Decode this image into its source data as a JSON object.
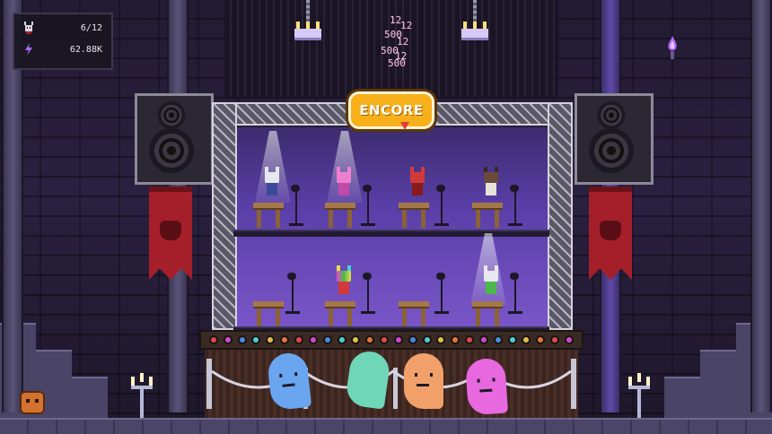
{
  "hud": {
    "fans_icon": "demon-head-icon",
    "fans_count": "6/12",
    "energy_icon": "lightning-icon",
    "energy_value": "62.88K"
  },
  "score_popups": [
    "12",
    "12",
    "500",
    "12",
    "500",
    "12",
    "500"
  ],
  "encore_button": {
    "label": "ENCORE"
  },
  "colors": {
    "stage_purple": "#5a3fa8",
    "encore_orange": "#f7b01a",
    "banner_red": "#a51f2b",
    "ghost_blue": "#6aa6f0",
    "ghost_teal": "#6fd6b8",
    "ghost_orange": "#f2a06a",
    "ghost_pink": "#e868e0"
  },
  "performers_top": [
    {
      "name": "white-demon-performer",
      "color": "#e8e8f0",
      "spotlight": true
    },
    {
      "name": "pink-demon-performer",
      "color": "#ee7fd0",
      "spotlight": true
    },
    {
      "name": "red-demon-performer",
      "color": "#d23a3a",
      "spotlight": false
    },
    {
      "name": "brown-demon-performer",
      "color": "#5a3a2a",
      "spotlight": false
    }
  ],
  "performers_bottom": [
    {
      "name": "empty-seat",
      "color": null,
      "spotlight": false
    },
    {
      "name": "rainbow-demon-performer",
      "color": "#e84ad0",
      "spotlight": false
    },
    {
      "name": "empty-seat",
      "color": null,
      "spotlight": false
    },
    {
      "name": "green-demon-performer",
      "color": "#4ab84a",
      "spotlight": true
    }
  ],
  "stage_lights": [
    "#e04a4a",
    "#d04ad0",
    "#4a8ae0",
    "#4ad0d0",
    "#e0c04a",
    "#e07a3a",
    "#e04a4a",
    "#d04ad0",
    "#4a8ae0",
    "#4ad0d0",
    "#e0c04a",
    "#e07a3a",
    "#e04a4a",
    "#d04ad0",
    "#4a8ae0",
    "#4ad0d0",
    "#e0c04a",
    "#e07a3a",
    "#e04a4a",
    "#d04ad0",
    "#4a8ae0",
    "#4ad0d0",
    "#e0c04a",
    "#e07a3a",
    "#e04a4a",
    "#d04ad0"
  ],
  "audience_icon": "face-icon"
}
